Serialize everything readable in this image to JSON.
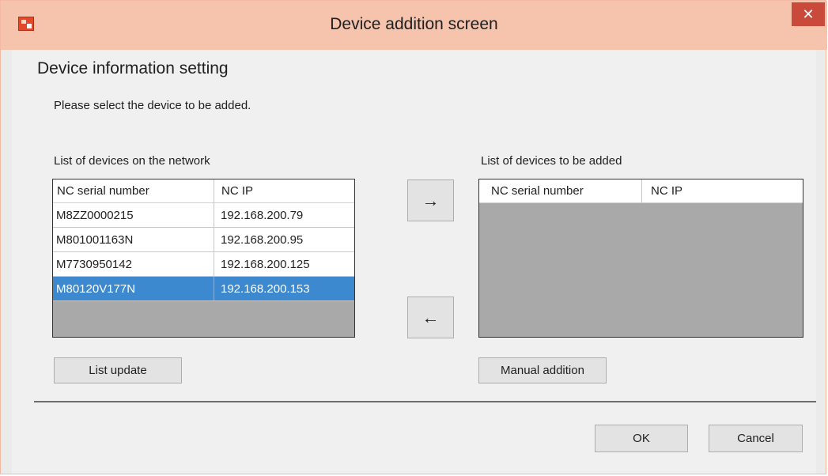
{
  "window": {
    "title": "Device addition screen",
    "close_label": "✕"
  },
  "section_title": "Device information setting",
  "instruction": "Please select the device to be added.",
  "network_list": {
    "label": "List of devices on the network",
    "columns": [
      "NC serial number",
      "NC IP"
    ],
    "rows": [
      {
        "serial": "M8ZZ0000215",
        "ip": "192.168.200.79",
        "selected": false
      },
      {
        "serial": "M801001163N",
        "ip": "192.168.200.95",
        "selected": false
      },
      {
        "serial": "M7730950142",
        "ip": "192.168.200.125",
        "selected": false
      },
      {
        "serial": "M80120V177N",
        "ip": "192.168.200.153",
        "selected": true
      }
    ]
  },
  "added_list": {
    "label": "List of devices to be added",
    "columns": [
      "NC serial number",
      "NC IP"
    ],
    "rows": []
  },
  "buttons": {
    "add_arrow": "→",
    "remove_arrow": "←",
    "list_update": "List update",
    "manual_addition": "Manual addition",
    "ok": "OK",
    "cancel": "Cancel"
  },
  "colors": {
    "titlebar": "#f6c3ac",
    "close": "#c94a3a",
    "selection": "#3c89d0",
    "empty_grid": "#a9a9aa"
  },
  "icons": {
    "app": "app-icon",
    "close": "close-icon"
  }
}
